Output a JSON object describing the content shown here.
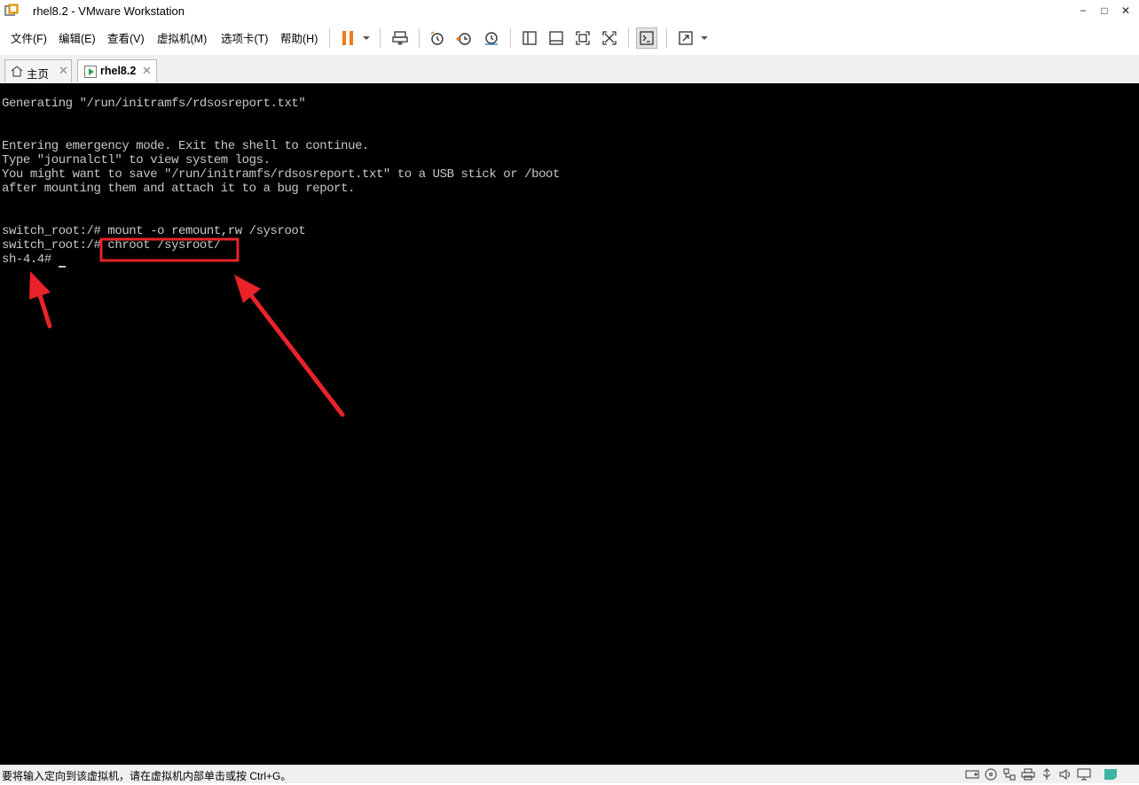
{
  "window": {
    "title": "rhel8.2 - VMware Workstation",
    "controls": {
      "minimize": "−",
      "maximize": "□",
      "close": "✕"
    }
  },
  "menu": {
    "items": [
      "文件(F)",
      "编辑(E)",
      "查看(V)",
      "虚拟机(M)",
      "选项卡(T)",
      "帮助(H)"
    ]
  },
  "toolbar": {
    "icons": [
      "pause-icon",
      "send-ctrl-alt-del-icon",
      "snapshot-icon",
      "revert-snapshot-icon",
      "snapshot-manager-icon",
      "show-library-icon",
      "thumbnail-bar-icon",
      "full-screen-icon",
      "unity-icon",
      "console-view-icon",
      "stretch-guest-icon"
    ],
    "accent": "#f07a1e"
  },
  "tabs": [
    {
      "label": "主页",
      "active": false
    },
    {
      "label": "rhel8.2",
      "active": true
    }
  ],
  "console": {
    "lines": [
      "Generating \"/run/initramfs/rdsosreport.txt\"",
      "",
      "",
      "Entering emergency mode. Exit the shell to continue.",
      "Type \"journalctl\" to view system logs.",
      "You might want to save \"/run/initramfs/rdsosreport.txt\" to a USB stick or /boot",
      "after mounting them and attach it to a bug report.",
      "",
      "",
      "switch_root:/# mount -o remount,rw /sysroot",
      "switch_root:/# chroot /sysroot/",
      "sh-4.4# "
    ],
    "background": "#000000",
    "foreground": "#c8c8c8",
    "annotation_color": "#e8232a"
  },
  "statusbar": {
    "text": "要将输入定向到该虚拟机，请在虚拟机内部单击或按 Ctrl+G。",
    "icons": [
      "hard-disk-icon",
      "cd-dvd-icon",
      "network-adapter-icon",
      "printer-icon",
      "usb-icon",
      "sound-card-icon",
      "display-icon",
      "message-icon"
    ]
  }
}
